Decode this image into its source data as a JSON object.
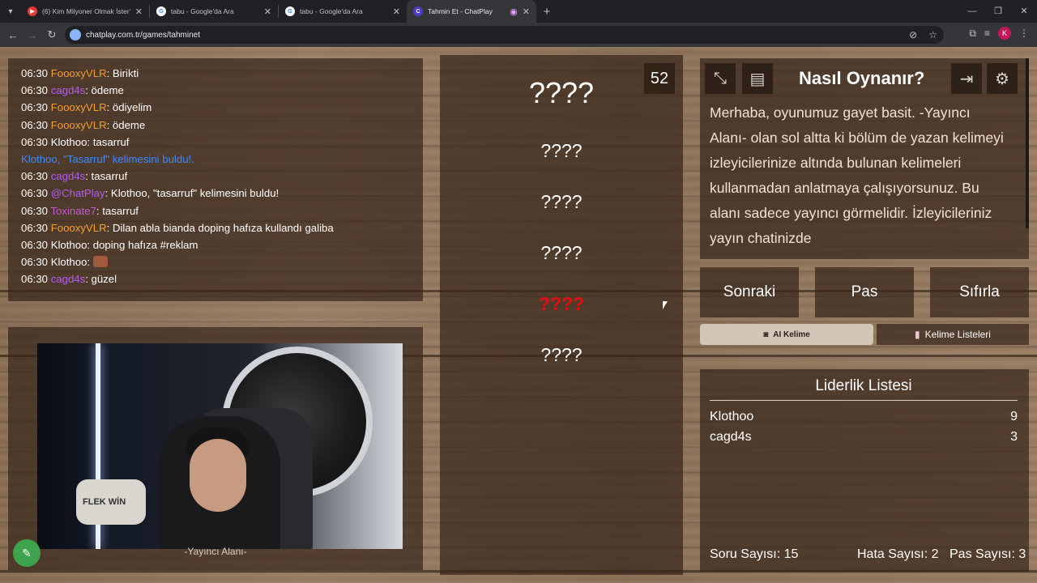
{
  "browser": {
    "tabs": [
      {
        "title": "(6) Kim Milyoner Olmak İster? T",
        "favicon": "youtube-icon",
        "active": false
      },
      {
        "title": "tabu - Google'da Ara",
        "favicon": "google-icon",
        "active": false
      },
      {
        "title": "tabu - Google'da Ara",
        "favicon": "google-icon",
        "active": false
      },
      {
        "title": "Tahmin Et - ChatPlay",
        "favicon": "chatplay-icon",
        "active": true
      }
    ],
    "url": "chatplay.com.tr/games/tahminet",
    "profile_initial": "K"
  },
  "chat": {
    "messages": [
      {
        "time": "06:30",
        "user": "FoooxyVLR",
        "color": "#f59e2e",
        "text": ": Birikti"
      },
      {
        "time": "06:30",
        "user": "cagd4s",
        "color": "#b15cf0",
        "text": ": ödeme"
      },
      {
        "time": "06:30",
        "user": "FoooxyVLR",
        "color": "#f59e2e",
        "text": ": ödiyelim"
      },
      {
        "time": "06:30",
        "user": "FoooxyVLR",
        "color": "#f59e2e",
        "text": ": ödeme"
      },
      {
        "time": "06:30",
        "user": "Klothoo",
        "color": "#ffffff",
        "text": ": tasarruf"
      },
      {
        "system": true,
        "text": "Klothoo, \"Tasarruf\" kelimesini buldu!."
      },
      {
        "time": "06:30",
        "user": "cagd4s",
        "color": "#b15cf0",
        "text": ": tasarruf"
      },
      {
        "time": "06:30",
        "user": "@ChatPlay",
        "color": "#b15cf0",
        "text": ": Klothoo, \"tasarruf\" kelimesini buldu!"
      },
      {
        "time": "06:30",
        "user": "Toxinate7",
        "color": "#c25ad0",
        "text": ": tasarruf"
      },
      {
        "time": "06:30",
        "user": "FoooxyVLR",
        "color": "#f59e2e",
        "text": ": Dilan abla bianda doping hafıza kullandı galiba"
      },
      {
        "time": "06:30",
        "user": "Klothoo",
        "color": "#ffffff",
        "text": ": doping hafıza #reklam"
      },
      {
        "time": "06:30",
        "user": "Klothoo",
        "color": "#ffffff",
        "text": ": ",
        "emote": true
      },
      {
        "time": "06:30",
        "user": "cagd4s",
        "color": "#b15cf0",
        "text": ": güzel"
      }
    ]
  },
  "stream": {
    "label": "-Yayıncı Alanı-",
    "pillow_text": "FLEK WİN"
  },
  "words": {
    "counter": "52",
    "main": "????",
    "list": [
      "????",
      "????",
      "????",
      "????",
      "????"
    ],
    "highlight_index": 3
  },
  "howto": {
    "title": "Nasıl Oynanır?",
    "text": "Merhaba, oyunumuz gayet basit. -Yayıncı Alanı- olan sol altta ki bölüm de yazan kelimeyi izleyicilerinize altında bulunan kelimeleri kullanmadan anlatmaya çalışıyorsunuz. Bu alanı sadece yayıncı görmelidir. İzleyicileriniz yayın chatinizde"
  },
  "controls": {
    "next": "Sonraki",
    "pass": "Pas",
    "reset": "Sıfırla",
    "ai_word": "AI Kelime",
    "word_lists": "Kelime Listeleri"
  },
  "leaderboard": {
    "title": "Liderlik Listesi",
    "rows": [
      {
        "name": "Klothoo",
        "score": "9"
      },
      {
        "name": "cagd4s",
        "score": "3"
      }
    ],
    "question_count": "Soru Sayısı: 15",
    "error_count": "Hata Sayısı: 2",
    "pass_count": "Pas Sayısı: 3"
  },
  "colors": {
    "system_msg": "#3d8bff",
    "highlight_word": "#e01010",
    "accent_green": "#3fa34d"
  }
}
